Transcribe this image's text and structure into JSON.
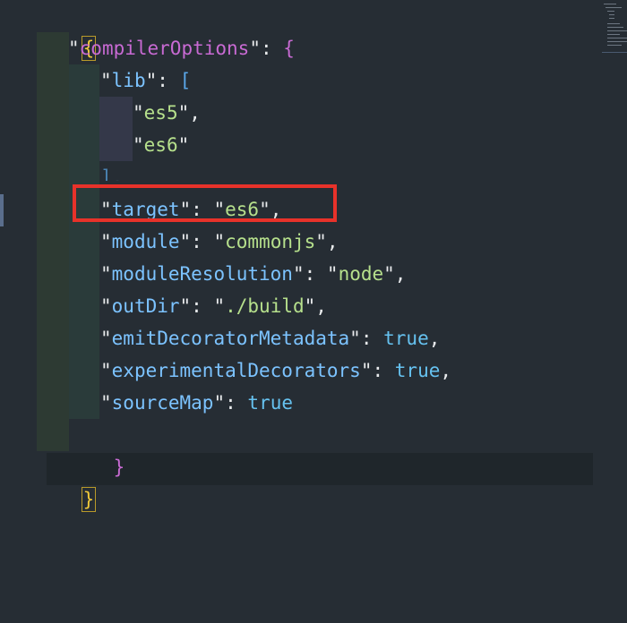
{
  "code": {
    "open_brace": "{",
    "compiler_options_key": "compilerOptions",
    "colon": ":",
    "lib_key": "lib",
    "lib_open": "[",
    "lib_values": [
      "es5",
      "es6"
    ],
    "lib_close": "],",
    "entries": [
      {
        "key": "target",
        "value": "es6",
        "quoted": true
      },
      {
        "key": "module",
        "value": "commonjs",
        "quoted": true
      },
      {
        "key": "moduleResolution",
        "value": "node",
        "quoted": true
      },
      {
        "key": "outDir",
        "value": "./build",
        "quoted": true
      },
      {
        "key": "emitDecoratorMetadata",
        "value": "true",
        "quoted": false
      },
      {
        "key": "experimentalDecorators",
        "value": "true",
        "quoted": false
      },
      {
        "key": "sourceMap",
        "value": "true",
        "quoted": false
      }
    ],
    "inner_close": "}",
    "close_brace": "}"
  },
  "highlight": {
    "color": "#e8322a",
    "target_entry": "target"
  },
  "colors": {
    "background": "#262d34",
    "string_value": "#b6e08c",
    "key_purple": "#c86ad3",
    "key_blue": "#7cc3ff",
    "brace_yellow": "#f0c93a",
    "boolean": "#66c2f0"
  }
}
